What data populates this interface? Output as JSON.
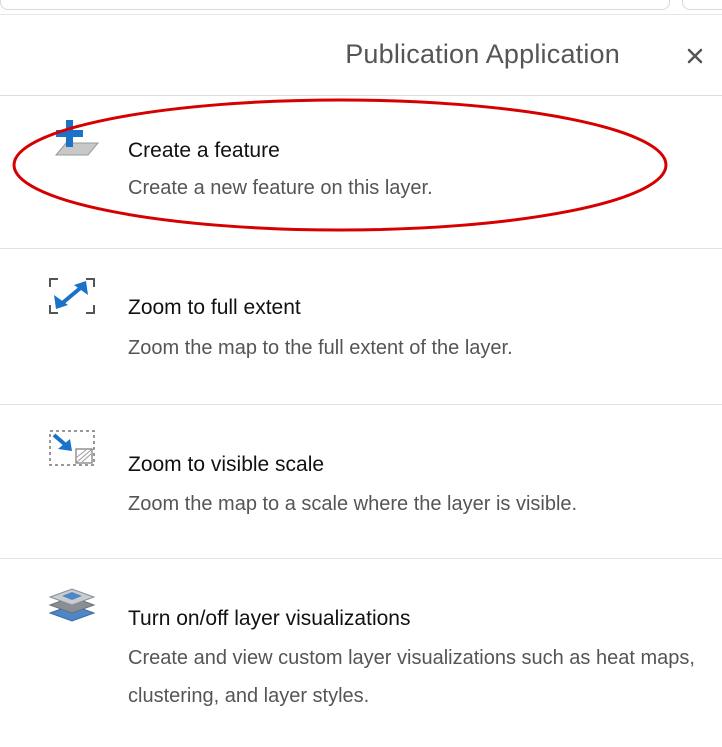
{
  "panel": {
    "title": "Publication Application",
    "close_label": "×"
  },
  "actions": [
    {
      "title": "Create a feature",
      "description": "Create a new feature on this layer.",
      "icon": "create-feature-icon"
    },
    {
      "title": "Zoom to full extent",
      "description": "Zoom the map to the full extent of the layer.",
      "icon": "full-extent-icon"
    },
    {
      "title": "Zoom to visible scale",
      "description": "Zoom the map to a scale where the layer is visible.",
      "icon": "visible-scale-icon"
    },
    {
      "title": "Turn on/off layer visualizations",
      "description": "Create and view custom layer visualizations such as heat maps, clustering, and layer styles.",
      "icon": "layers-icon"
    }
  ],
  "colors": {
    "accent_blue": "#1a73c8",
    "highlight_red": "#d60000",
    "divider": "#e2e2e2"
  }
}
